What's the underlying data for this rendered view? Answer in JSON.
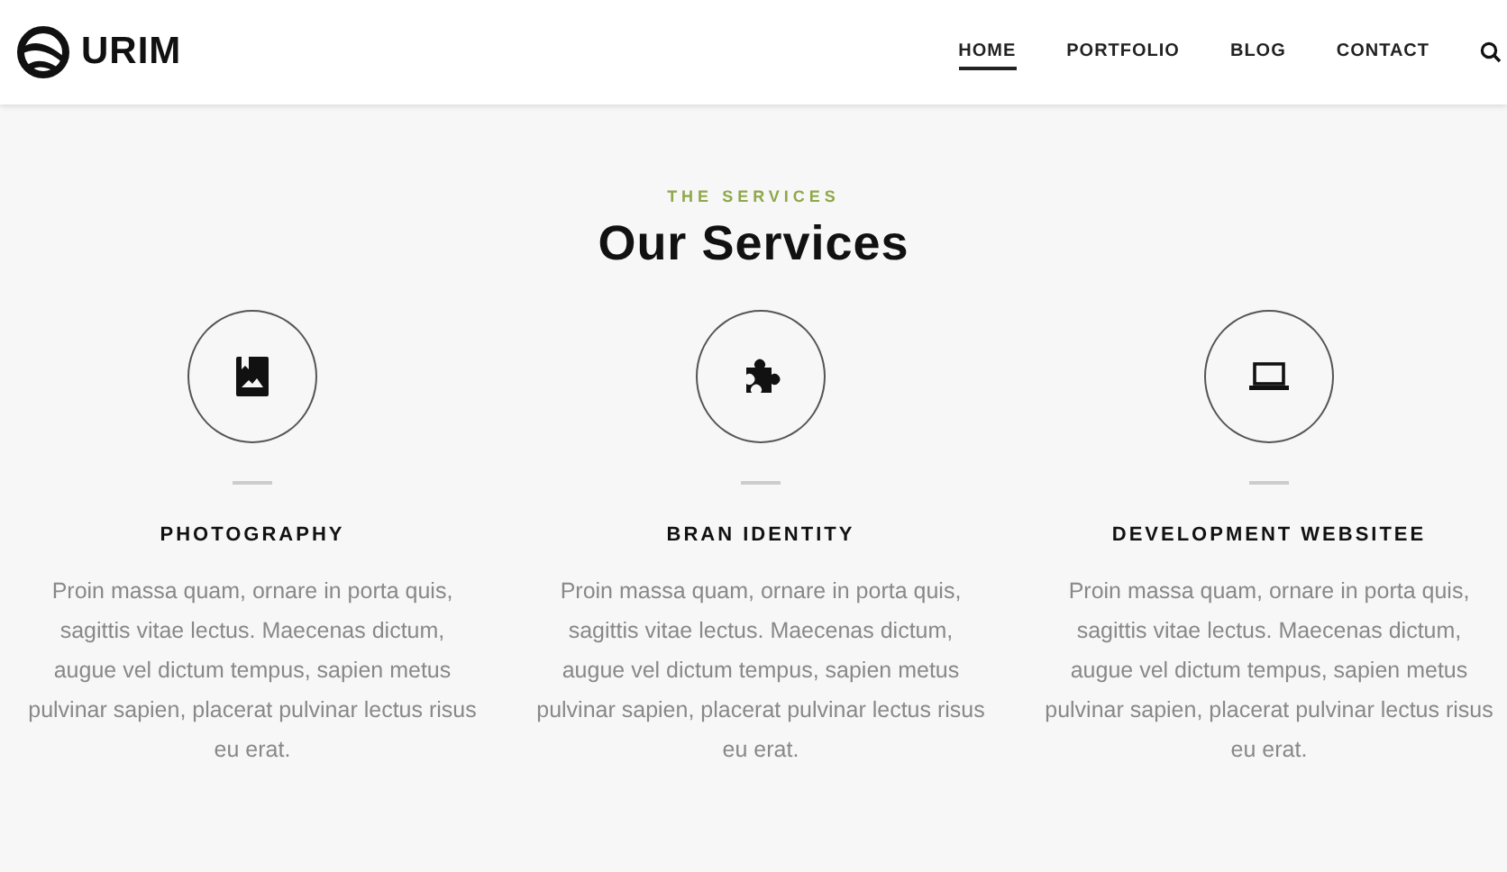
{
  "header": {
    "logo": "URIM",
    "nav": [
      {
        "label": "HOME",
        "selected": true
      },
      {
        "label": "PORTFOLIO",
        "selected": false
      },
      {
        "label": "BLOG",
        "selected": false
      },
      {
        "label": "CONTACT",
        "selected": false
      }
    ]
  },
  "services": {
    "eyebrow": "THE SERVICES",
    "title": "Our Services",
    "items": [
      {
        "kind": "photo",
        "title": "PHOTOGRAPHY",
        "text": "Proin massa quam, ornare in porta quis, sagittis vitae lectus. Maecenas dictum, augue vel dictum tempus, sapien metus pulvinar sapien, placerat pulvinar lectus risus eu erat."
      },
      {
        "kind": "puzzle",
        "title": "BRAN IDENTITY",
        "text": "Proin massa quam, ornare in porta quis, sagittis vitae lectus. Maecenas dictum, augue vel dictum tempus, sapien metus pulvinar sapien, placerat pulvinar lectus risus eu erat."
      },
      {
        "kind": "laptop",
        "title": "DEVELOPMENT WEBSITEE",
        "text": "Proin massa quam, ornare in porta quis, sagittis vitae lectus. Maecenas dictum, augue vel dictum tempus, sapien metus pulvinar sapien, placerat pulvinar lectus risus eu erat."
      }
    ]
  }
}
